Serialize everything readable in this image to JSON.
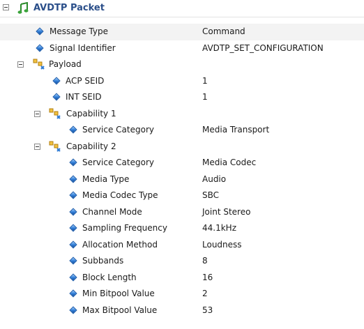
{
  "root": {
    "title": "AVDTP Packet",
    "icon": "music-note-icon"
  },
  "fields": [
    {
      "label": "Message Type",
      "value": "Command"
    },
    {
      "label": "Signal Identifier",
      "value": "AVDTP_SET_CONFIGURATION"
    }
  ],
  "payload": {
    "label": "Payload",
    "fields": [
      {
        "label": "ACP SEID",
        "value": "1"
      },
      {
        "label": "INT SEID",
        "value": "1"
      }
    ],
    "capability1": {
      "label": "Capability 1",
      "fields": [
        {
          "label": "Service Category",
          "value": "Media Transport"
        }
      ]
    },
    "capability2": {
      "label": "Capability 2",
      "fields": [
        {
          "label": "Service Category",
          "value": "Media Codec"
        },
        {
          "label": "Media Type",
          "value": "Audio"
        },
        {
          "label": "Media Codec Type",
          "value": "SBC"
        },
        {
          "label": "Channel Mode",
          "value": "Joint Stereo"
        },
        {
          "label": "Sampling Frequency",
          "value": "44.1kHz"
        },
        {
          "label": "Allocation Method",
          "value": "Loudness"
        },
        {
          "label": "Subbands",
          "value": "8"
        },
        {
          "label": "Block Length",
          "value": "16"
        },
        {
          "label": "Min Bitpool Value",
          "value": "2"
        },
        {
          "label": "Max Bitpool Value",
          "value": "53"
        }
      ]
    }
  },
  "colors": {
    "title": "#2b4f8a",
    "field_icon": "#2e7bd6",
    "group_icon": "#e8a81c",
    "row_highlight": "#f3f3f3"
  }
}
